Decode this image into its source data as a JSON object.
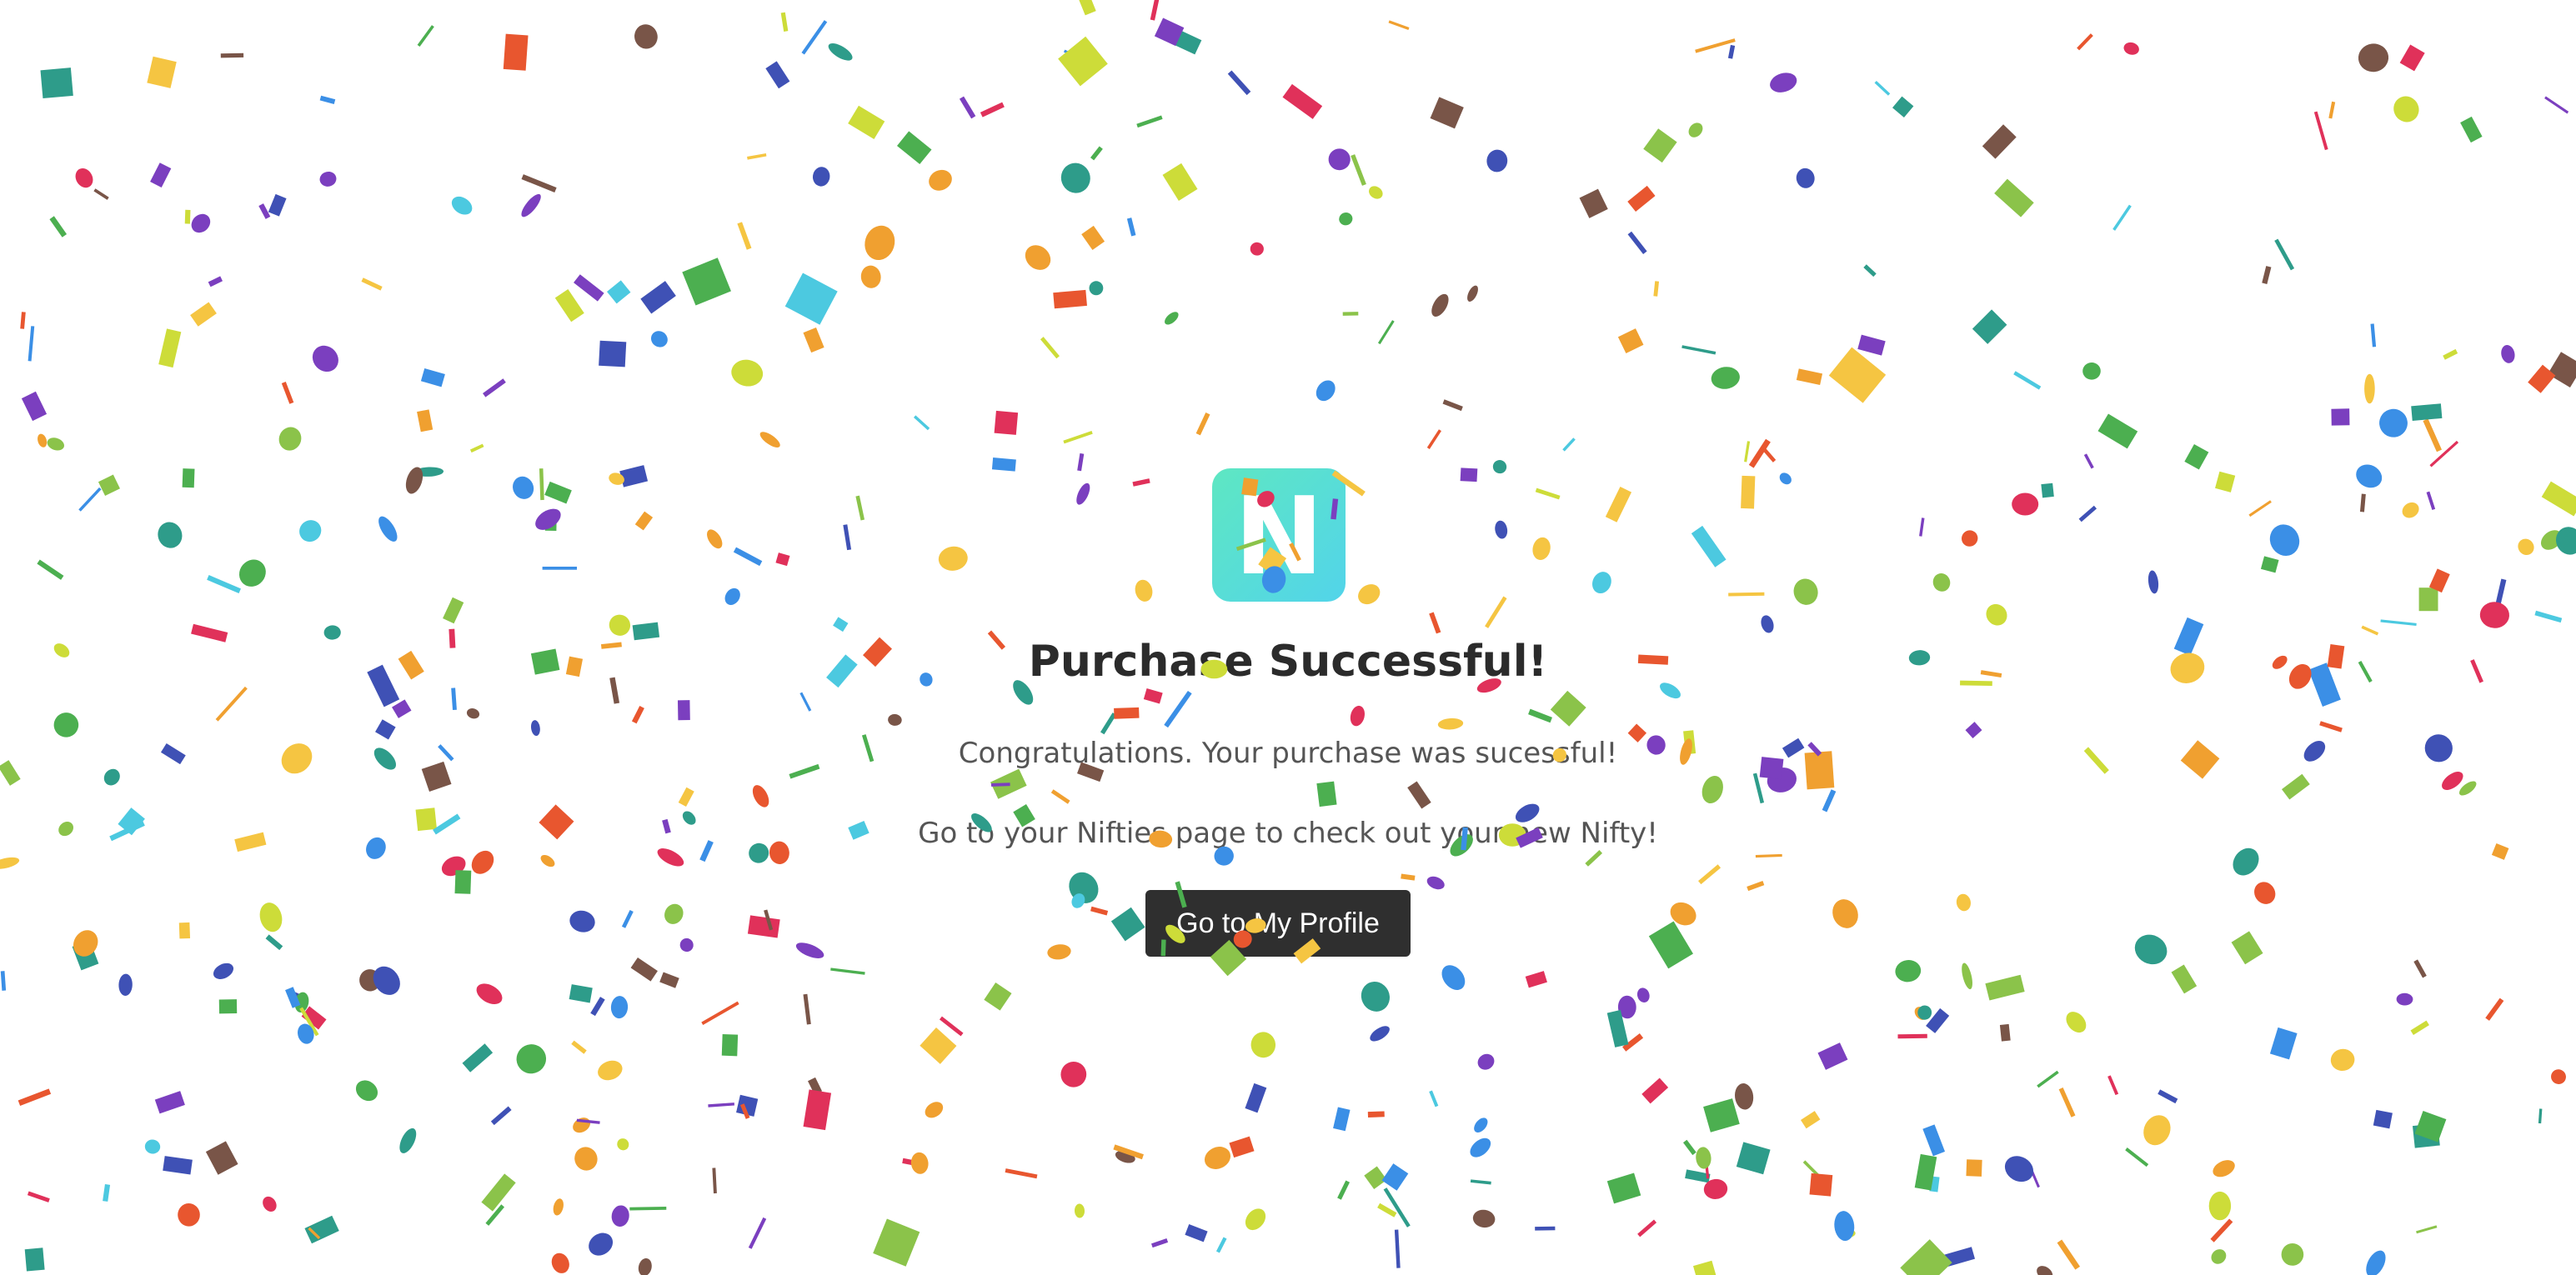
{
  "logo": {
    "letter": "N",
    "icon": "nifty-logo-icon"
  },
  "title": "Purchase Successful!",
  "messages": {
    "congrats": "Congratulations. Your purchase was sucessful!",
    "instruction": "Go to your Nifties page to check out your new Nifty!"
  },
  "actions": {
    "profile_button_label": "Go to My Profile"
  },
  "colors": {
    "logo_gradient_start": "#5ee7c2",
    "logo_gradient_end": "#52d4ea",
    "button_background": "#2f2f2f",
    "title_text": "#2b2b2b",
    "body_text": "#555555"
  },
  "confetti_palette": [
    "#e8562f",
    "#f0a030",
    "#4caf50",
    "#3b8fe6",
    "#7b3fbf",
    "#e0315a",
    "#f5c542",
    "#8bc34a",
    "#2e9c8a",
    "#795548",
    "#3f51b5",
    "#4cc9e0",
    "#cddc39"
  ]
}
